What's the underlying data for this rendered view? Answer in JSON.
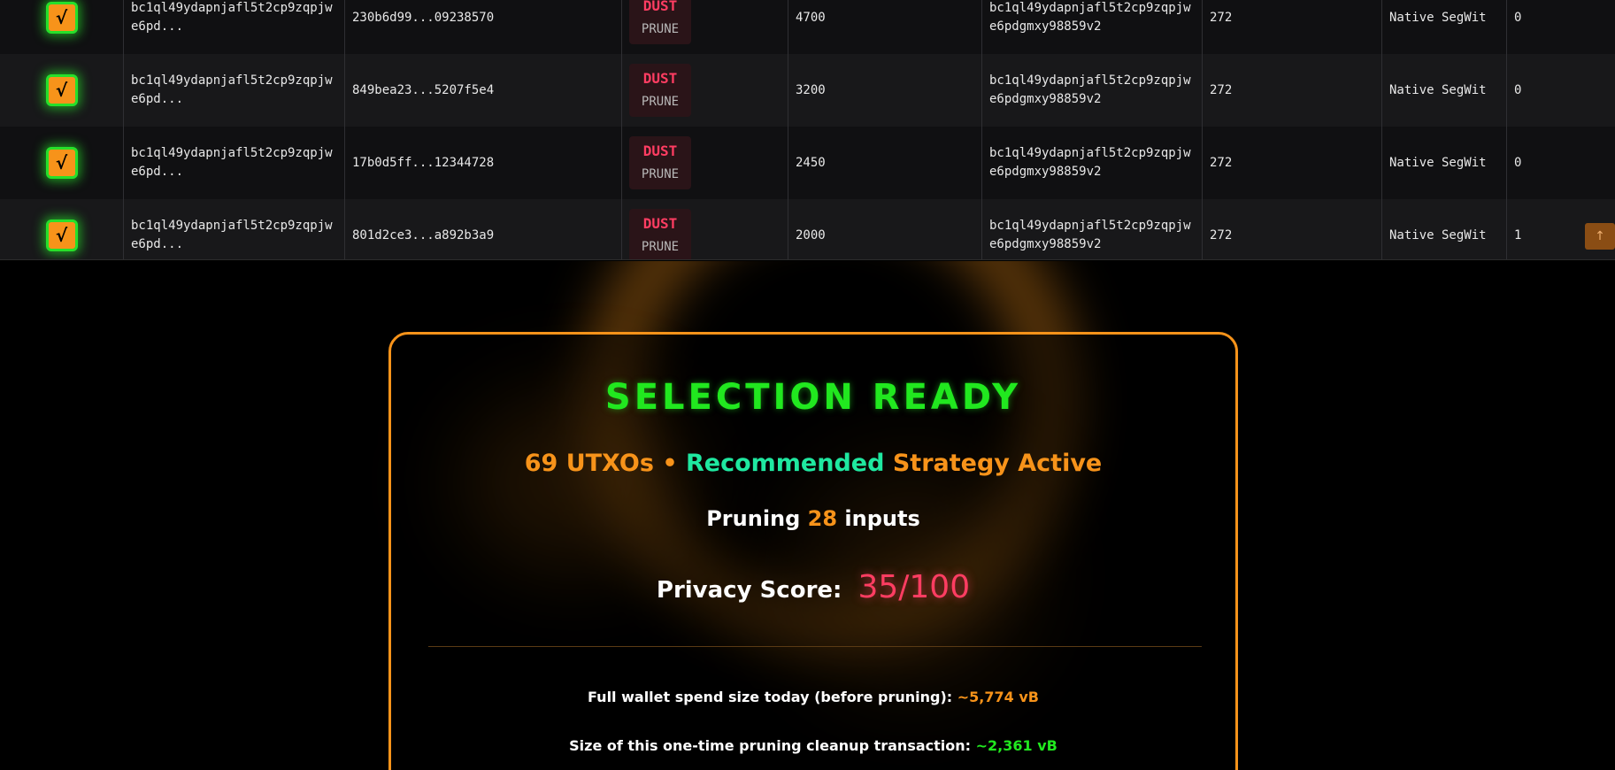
{
  "table": {
    "rows": [
      {
        "check": "√",
        "address": "bc1ql49ydapnjafl5t2cp9zqpjw\ne6pd...",
        "txid": "230b6d99...09238570",
        "tag_primary": "DUST",
        "tag_secondary": "PRUNE",
        "value": "4700",
        "change_address": "bc1ql49ydapnjafl5t2cp9zqpjw\ne6pdgmxy98859v2",
        "size": "272",
        "script_type": "Native SegWit",
        "confirmations": "0"
      },
      {
        "check": "√",
        "address": "bc1ql49ydapnjafl5t2cp9zqpjw\ne6pd...",
        "txid": "849bea23...5207f5e4",
        "tag_primary": "DUST",
        "tag_secondary": "PRUNE",
        "value": "3200",
        "change_address": "bc1ql49ydapnjafl5t2cp9zqpjw\ne6pdgmxy98859v2",
        "size": "272",
        "script_type": "Native SegWit",
        "confirmations": "0"
      },
      {
        "check": "√",
        "address": "bc1ql49ydapnjafl5t2cp9zqpjw\ne6pd...",
        "txid": "17b0d5ff...12344728",
        "tag_primary": "DUST",
        "tag_secondary": "PRUNE",
        "value": "2450",
        "change_address": "bc1ql49ydapnjafl5t2cp9zqpjw\ne6pdgmxy98859v2",
        "size": "272",
        "script_type": "Native SegWit",
        "confirmations": "0"
      },
      {
        "check": "√",
        "address": "bc1ql49ydapnjafl5t2cp9zqpjw\ne6pd...",
        "txid": "801d2ce3...a892b3a9",
        "tag_primary": "DUST",
        "tag_secondary": "PRUNE",
        "value": "2000",
        "change_address": "bc1ql49ydapnjafl5t2cp9zqpjw\ne6pdgmxy98859v2",
        "size": "272",
        "script_type": "Native SegWit",
        "confirmations": "1"
      }
    ]
  },
  "scroll_top_icon": "↑",
  "summary": {
    "title": "SELECTION READY",
    "utxo_count": "69 UTXOs",
    "bullet": " • ",
    "strategy_highlight": "Recommended",
    "strategy_rest": " Strategy Active",
    "prune_prefix": "Pruning ",
    "prune_count": "28",
    "prune_suffix": " inputs",
    "privacy_label": "Privacy Score:",
    "privacy_value": "35/100",
    "full_spend_label": "Full wallet spend size today (before pruning): ",
    "full_spend_value": "~5,774 vB",
    "cleanup_label": "Size of this one-time pruning cleanup transaction: ",
    "cleanup_value": "~2,361 vB"
  },
  "colors": {
    "accent": "#f7931a",
    "success": "#21e81f",
    "danger": "#ff3d62",
    "recommended": "#1fe8a0"
  }
}
